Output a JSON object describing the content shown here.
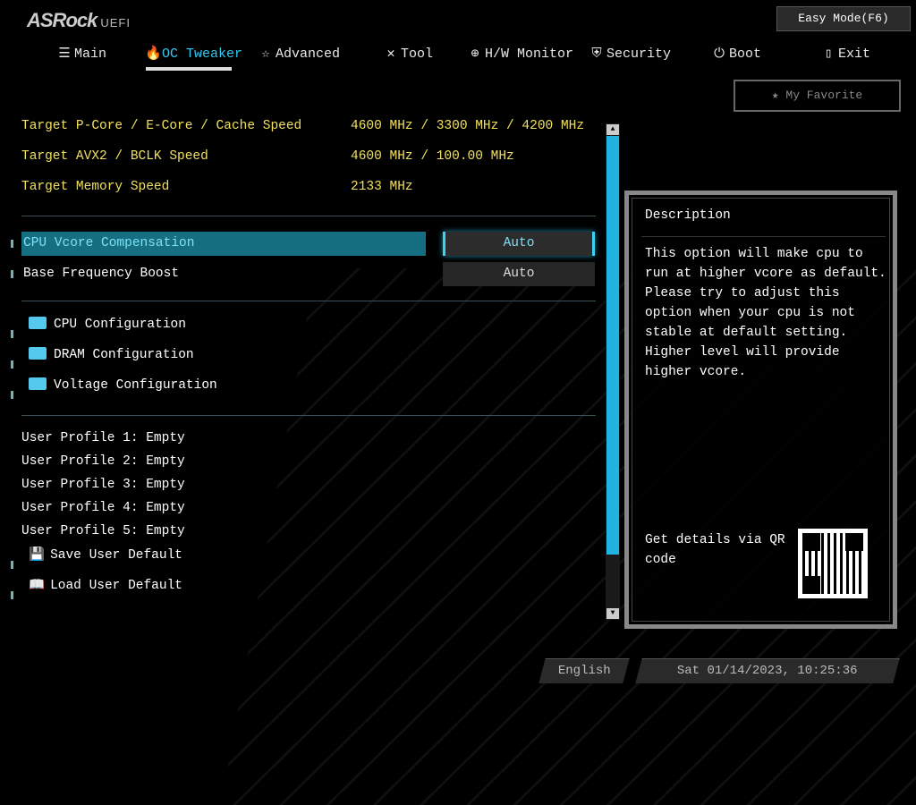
{
  "header": {
    "logo": "ASRock",
    "logo_sub": "UEFI",
    "easy_mode": "Easy Mode(F6)",
    "my_favorite": "My Favorite"
  },
  "tabs": [
    {
      "label": "Main",
      "icon": "list-icon"
    },
    {
      "label": "OC Tweaker",
      "icon": "rocket-icon"
    },
    {
      "label": "Advanced",
      "icon": "star-icon"
    },
    {
      "label": "Tool",
      "icon": "tools-icon"
    },
    {
      "label": "H/W Monitor",
      "icon": "monitor-icon"
    },
    {
      "label": "Security",
      "icon": "shield-icon"
    },
    {
      "label": "Boot",
      "icon": "power-icon"
    },
    {
      "label": "Exit",
      "icon": "exit-icon"
    }
  ],
  "info": [
    {
      "label": "Target P-Core / E-Core / Cache Speed",
      "value": "4600 MHz / 3300 MHz / 4200 MHz"
    },
    {
      "label": "Target AVX2 / BCLK Speed",
      "value": "4600 MHz / 100.00 MHz"
    },
    {
      "label": "Target Memory Speed",
      "value": "2133 MHz"
    }
  ],
  "settings": [
    {
      "label": "CPU Vcore Compensation",
      "value": "Auto"
    },
    {
      "label": "Base Frequency Boost",
      "value": "Auto"
    }
  ],
  "submenus": [
    "CPU Configuration",
    "DRAM Configuration",
    "Voltage Configuration"
  ],
  "profiles": [
    "User Profile 1: Empty",
    "User Profile 2: Empty",
    "User Profile 3: Empty",
    "User Profile 4: Empty",
    "User Profile 5: Empty"
  ],
  "actions": [
    "Save User Default",
    "Load User Default"
  ],
  "description": {
    "title": "Description",
    "text": "This option will make cpu to\nrun at higher vcore as default.\nPlease try to adjust this\noption when your cpu is not\nstable at default setting.\nHigher level will provide\nhigher vcore.",
    "qr_text": "Get details via QR code"
  },
  "footer": {
    "language": "English",
    "datetime": "Sat 01/14/2023, 10:25:36"
  },
  "colors": {
    "accent": "#33c8f0",
    "yellow": "#f0e060",
    "selection": "#156f80"
  }
}
